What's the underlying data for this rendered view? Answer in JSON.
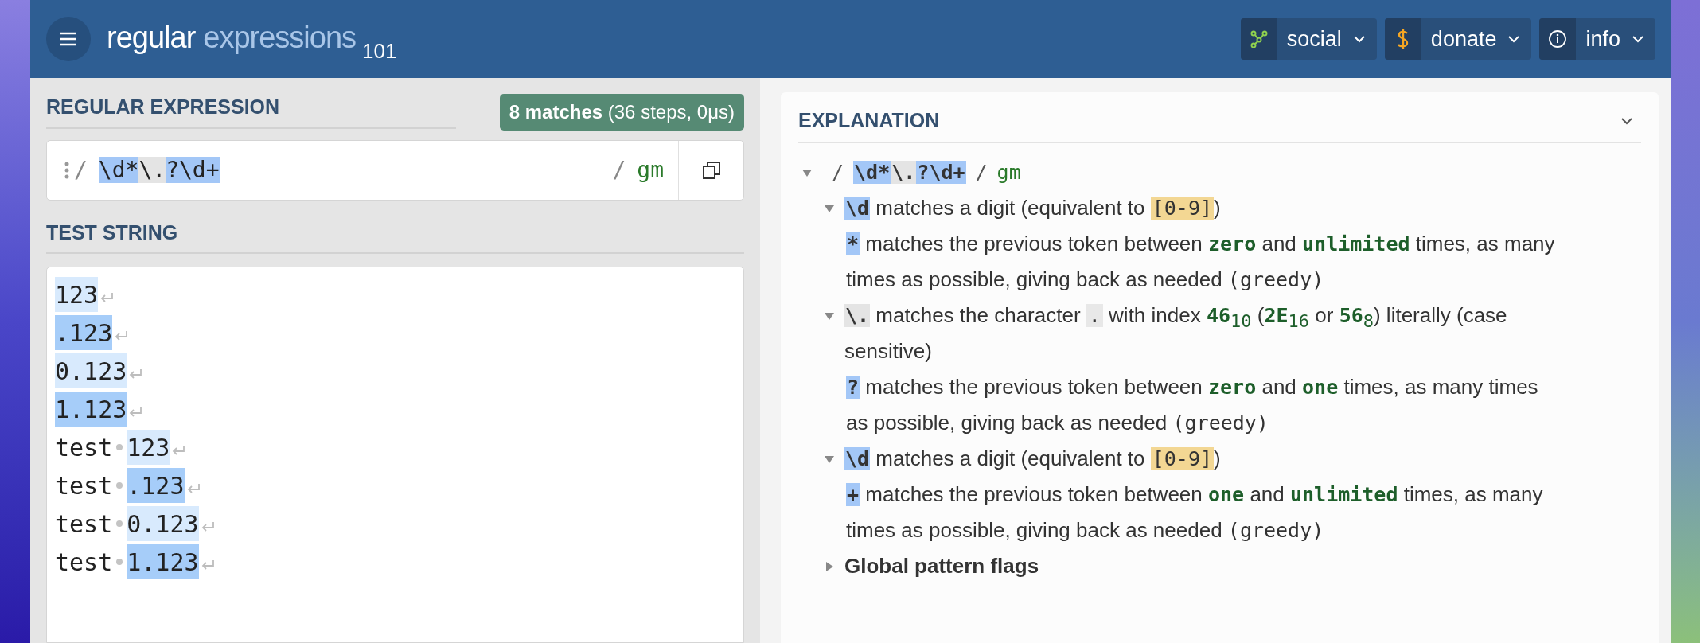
{
  "header": {
    "logo": {
      "primary": "regular",
      "secondary": "expressions",
      "version": "101"
    },
    "buttons": [
      {
        "kind": "social",
        "label": "social"
      },
      {
        "kind": "donate",
        "label": "donate"
      },
      {
        "kind": "info",
        "label": "info"
      }
    ]
  },
  "regex_panel": {
    "title": "REGULAR EXPRESSION",
    "match_info": "**8 matches** (36 steps, 0μs)",
    "delimiter_open": "/",
    "tokens": [
      {
        "text": "\\d*",
        "color": "#a3c7f7"
      },
      {
        "text": "\\.",
        "color": "#e4e4e4"
      },
      {
        "text": "?\\d+",
        "color": "#a3c7f7"
      }
    ],
    "delimiter_close": "/",
    "flags": "gm"
  },
  "test_string": {
    "title": "TEST STRING",
    "lines": [
      {
        "match": "123",
        "color": "#d8eafd"
      },
      {
        "match": ".123",
        "color": "#a6cdf9"
      },
      {
        "match": "0.123",
        "color": "#d8eafd"
      },
      {
        "match": "1.123",
        "color": "#a6cdf9"
      },
      {
        "before": "test",
        "space_marker": true,
        "match": "123",
        "color": "#d8eafd"
      },
      {
        "before": "test",
        "space_marker": true,
        "match": ".123",
        "color": "#a6cdf9"
      },
      {
        "before": "test",
        "space_marker": true,
        "match": "0.123",
        "color": "#d8eafd"
      },
      {
        "before": "test",
        "space_marker": true,
        "match": "1.123",
        "color": "#a6cdf9"
      }
    ]
  },
  "explanation": {
    "title": "EXPLANATION",
    "expanded": true,
    "tree": [
      {
        "expanded": true,
        "segments": [
          {
            "kind": "punct",
            "text": "/"
          },
          {
            "kind": "token",
            "text": "\\d*",
            "color": "#a3c7f7"
          },
          {
            "kind": "token",
            "text": "\\.",
            "color": "#e4e4e4"
          },
          {
            "kind": "token",
            "text": "?\\d+",
            "color": "#a3c7f7"
          },
          {
            "kind": "punct",
            "text": "/"
          },
          {
            "kind": "flags",
            "text": "gm"
          }
        ],
        "children": [
          {
            "expanded": true,
            "segments": [
              {
                "kind": "token",
                "text": "\\d",
                "color": "#a3c7f7"
              },
              {
                "kind": "text",
                "text": " matches a digit (equivalent to "
              },
              {
                "kind": "class",
                "text": "[0-9]"
              },
              {
                "kind": "text",
                "text": ")"
              }
            ],
            "children": [
              {
                "segments": [
                  {
                    "kind": "token",
                    "text": "*",
                    "color": "#a3c7f7"
                  },
                  {
                    "kind": "text",
                    "text": " matches the previous token between "
                  },
                  {
                    "kind": "keyword",
                    "text": "zero"
                  },
                  {
                    "kind": "text",
                    "text": " and "
                  },
                  {
                    "kind": "keyword",
                    "text": "unlimited"
                  },
                  {
                    "kind": "text",
                    "text": " times, as many times as possible, giving back as needed "
                  },
                  {
                    "kind": "code",
                    "text": "(greedy)"
                  }
                ]
              }
            ]
          },
          {
            "expanded": true,
            "segments": [
              {
                "kind": "token",
                "text": "\\.",
                "color": "#e4e4e4"
              },
              {
                "kind": "text",
                "text": " matches the character "
              },
              {
                "kind": "char",
                "text": "."
              },
              {
                "kind": "text",
                "text": " with index "
              },
              {
                "kind": "number",
                "text": "46",
                "sub": "10"
              },
              {
                "kind": "text",
                "text": " ("
              },
              {
                "kind": "number",
                "text": "2E",
                "sub": "16"
              },
              {
                "kind": "text",
                "text": " or "
              },
              {
                "kind": "number",
                "text": "56",
                "sub": "8"
              },
              {
                "kind": "text",
                "text": ") literally (case sensitive)"
              }
            ],
            "children": [
              {
                "segments": [
                  {
                    "kind": "token",
                    "text": "?",
                    "color": "#a3c7f7"
                  },
                  {
                    "kind": "text",
                    "text": " matches the previous token between "
                  },
                  {
                    "kind": "keyword",
                    "text": "zero"
                  },
                  {
                    "kind": "text",
                    "text": " and "
                  },
                  {
                    "kind": "keyword",
                    "text": "one"
                  },
                  {
                    "kind": "text",
                    "text": " times, as many times as possible, giving back as needed "
                  },
                  {
                    "kind": "code",
                    "text": "(greedy)"
                  }
                ]
              }
            ]
          },
          {
            "expanded": true,
            "segments": [
              {
                "kind": "token",
                "text": "\\d",
                "color": "#a3c7f7"
              },
              {
                "kind": "text",
                "text": " matches a digit (equivalent to "
              },
              {
                "kind": "class",
                "text": "[0-9]"
              },
              {
                "kind": "text",
                "text": ")"
              }
            ],
            "children": [
              {
                "segments": [
                  {
                    "kind": "token",
                    "text": "+",
                    "color": "#a3c7f7"
                  },
                  {
                    "kind": "text",
                    "text": " matches the previous token between "
                  },
                  {
                    "kind": "keyword",
                    "text": "one"
                  },
                  {
                    "kind": "text",
                    "text": " and "
                  },
                  {
                    "kind": "keyword",
                    "text": "unlimited"
                  },
                  {
                    "kind": "text",
                    "text": " times, as many times as possible, giving back as needed "
                  },
                  {
                    "kind": "code",
                    "text": "(greedy)"
                  }
                ]
              }
            ]
          },
          {
            "expanded": false,
            "bold": true,
            "segments": [
              {
                "kind": "text",
                "text": "Global pattern flags"
              }
            ]
          }
        ]
      }
    ]
  }
}
